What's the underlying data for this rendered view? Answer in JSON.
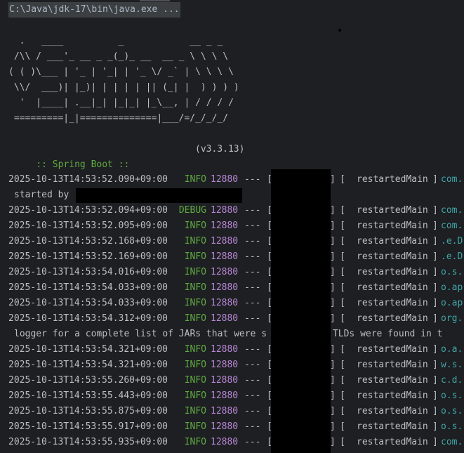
{
  "command": "C:\\Java\\jdk-17\\bin\\java.exe ...",
  "banner": "  .   ____          _            __ _ _\n /\\\\ / ___'_ __ _ _(_)_ __  __ _ \\ \\ \\ \\\n( ( )\\___ | '_ | '_| | '_ \\/ _` | \\ \\ \\ \\\n \\\\/  ___)| |_)| | | | | || (_| |  ) ) ) )\n  '  |____| .__|_| |_|_| |_\\__, | / / / /\n =========|_|==============|___/=/_/_/_/",
  "boot": {
    "label": ":: Spring Boot ::",
    "version": "(v3.3.13)"
  },
  "log": [
    {
      "ts": "2025-10-13T14:53:52.090+09:00",
      "level": "INFO",
      "pid": "12880",
      "sep": "---",
      "thread": "restartedMain",
      "logger": "com."
    },
    {
      "cont": "started by"
    },
    {
      "ts": "2025-10-13T14:53:52.094+09:00",
      "level": "DEBUG",
      "pid": "12880",
      "sep": "---",
      "thread": "restartedMain",
      "logger": "com."
    },
    {
      "ts": "2025-10-13T14:53:52.095+09:00",
      "level": "INFO",
      "pid": "12880",
      "sep": "---",
      "thread": "restartedMain",
      "logger": "com."
    },
    {
      "ts": "2025-10-13T14:53:52.168+09:00",
      "level": "INFO",
      "pid": "12880",
      "sep": "---",
      "thread": "restartedMain",
      "logger": ".e.D"
    },
    {
      "ts": "2025-10-13T14:53:52.169+09:00",
      "level": "INFO",
      "pid": "12880",
      "sep": "---",
      "thread": "restartedMain",
      "logger": ".e.D"
    },
    {
      "ts": "2025-10-13T14:53:54.016+09:00",
      "level": "INFO",
      "pid": "12880",
      "sep": "---",
      "thread": "restartedMain",
      "logger": "o.s."
    },
    {
      "ts": "2025-10-13T14:53:54.033+09:00",
      "level": "INFO",
      "pid": "12880",
      "sep": "---",
      "thread": "restartedMain",
      "logger": "o.ap"
    },
    {
      "ts": "2025-10-13T14:53:54.033+09:00",
      "level": "INFO",
      "pid": "12880",
      "sep": "---",
      "thread": "restartedMain",
      "logger": "o.ap"
    },
    {
      "ts": "2025-10-13T14:53:54.312+09:00",
      "level": "INFO",
      "pid": "12880",
      "sep": "---",
      "thread": "restartedMain",
      "logger": "org."
    },
    {
      "cont": "logger for a complete list of JARs that were s         no TLDs were found in t"
    },
    {
      "ts": "2025-10-13T14:53:54.321+09:00",
      "level": "INFO",
      "pid": "12880",
      "sep": "---",
      "thread": "restartedMain",
      "logger": "o.a."
    },
    {
      "ts": "2025-10-13T14:53:54.321+09:00",
      "level": "INFO",
      "pid": "12880",
      "sep": "---",
      "thread": "restartedMain",
      "logger": "w.s."
    },
    {
      "ts": "2025-10-13T14:53:55.260+09:00",
      "level": "INFO",
      "pid": "12880",
      "sep": "---",
      "thread": "restartedMain",
      "logger": "c.d."
    },
    {
      "ts": "2025-10-13T14:53:55.443+09:00",
      "level": "INFO",
      "pid": "12880",
      "sep": "---",
      "thread": "restartedMain",
      "logger": "o.s."
    },
    {
      "ts": "2025-10-13T14:53:55.875+09:00",
      "level": "INFO",
      "pid": "12880",
      "sep": "---",
      "thread": "restartedMain",
      "logger": "o.s."
    },
    {
      "ts": "2025-10-13T14:53:55.917+09:00",
      "level": "INFO",
      "pid": "12880",
      "sep": "---",
      "thread": "restartedMain",
      "logger": "o.s."
    },
    {
      "ts": "2025-10-13T14:53:55.935+09:00",
      "level": "INFO",
      "pid": "12880",
      "sep": "---",
      "thread": "restartedMain",
      "logger": "com."
    }
  ],
  "colors": {
    "background": "#1e1f22",
    "text": "#bcbec4",
    "level": "#5faa42",
    "pid": "#b887d6",
    "logger": "#3fa5a8",
    "redaction": "#000000"
  }
}
